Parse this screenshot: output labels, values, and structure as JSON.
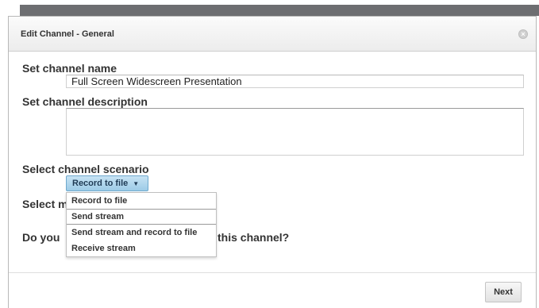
{
  "dialog": {
    "title": "Edit Channel - General",
    "close_icon": "close-icon"
  },
  "form": {
    "name_label": "Set channel name",
    "name_value": "Full Screen Widescreen Presentation",
    "description_label": "Set channel description",
    "description_value": "",
    "scenario_label": "Select channel scenario",
    "scenario_selected": "Record to file",
    "scenario_options": [
      "Record to file",
      "Send stream",
      "Send stream and record to file",
      "Receive stream"
    ],
    "partial_label_1": "Select m",
    "partial_label_2_start": "Do you ",
    "partial_label_2_end": "this channel?"
  },
  "footer": {
    "next_label": "Next"
  },
  "colors": {
    "accent": "#9dcbe7",
    "backdrop": "#6d6e71"
  }
}
